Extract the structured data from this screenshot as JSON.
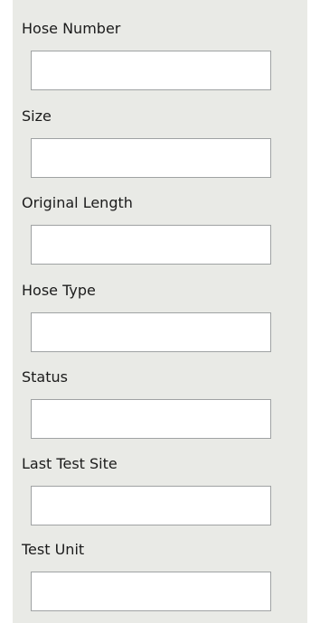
{
  "form": {
    "fields": [
      {
        "label": "Hose Number",
        "value": ""
      },
      {
        "label": "Size",
        "value": ""
      },
      {
        "label": "Original Length",
        "value": ""
      },
      {
        "label": "Hose Type",
        "value": ""
      },
      {
        "label": "Status",
        "value": ""
      },
      {
        "label": "Last Test Site",
        "value": ""
      },
      {
        "label": "Test Unit",
        "value": ""
      }
    ]
  }
}
